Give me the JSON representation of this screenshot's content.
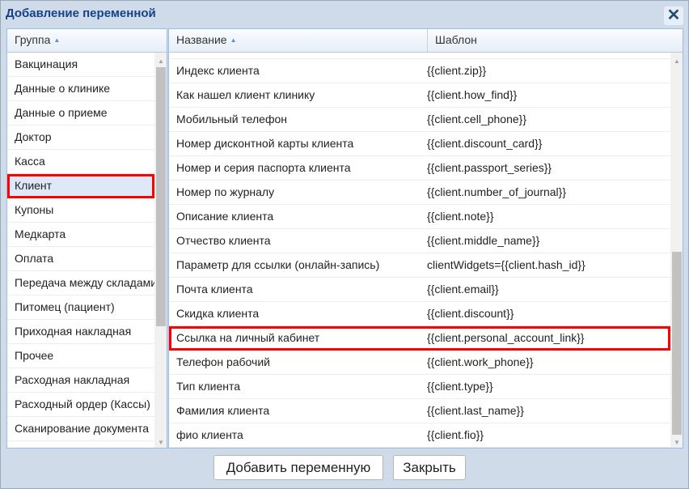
{
  "dialog": {
    "title": "Добавление переменной",
    "close": "✕"
  },
  "groups": {
    "header": "Группа",
    "items": [
      "Вакцинация",
      "Данные о клинике",
      "Данные о приеме",
      "Доктор",
      "Касса",
      "Клиент",
      "Купоны",
      "Медкарта",
      "Оплата",
      "Передача между складами",
      "Питомец (пациент)",
      "Приходная накладная",
      "Прочее",
      "Расходная накладная",
      "Расходный ордер (Кассы)",
      "Сканирование документа"
    ],
    "selected": "Клиент"
  },
  "variables": {
    "header_name": "Название",
    "header_template": "Шаблон",
    "rows": [
      {
        "name": "Индекс клиента",
        "template": "{{client.zip}}"
      },
      {
        "name": "Как нашел клиент клинику",
        "template": "{{client.how_find}}"
      },
      {
        "name": "Мобильный телефон",
        "template": "{{client.cell_phone}}"
      },
      {
        "name": "Номер дисконтной карты клиента",
        "template": "{{client.discount_card}}"
      },
      {
        "name": "Номер и серия паспорта клиента",
        "template": "{{client.passport_series}}"
      },
      {
        "name": "Номер по журналу",
        "template": "{{client.number_of_journal}}"
      },
      {
        "name": "Описание клиента",
        "template": "{{client.note}}"
      },
      {
        "name": "Отчество клиента",
        "template": "{{client.middle_name}}"
      },
      {
        "name": "Параметр для ссылки (онлайн-запись)",
        "template": "clientWidgets={{client.hash_id}}"
      },
      {
        "name": "Почта клиента",
        "template": "{{client.email}}"
      },
      {
        "name": "Скидка клиента",
        "template": "{{client.discount}}"
      },
      {
        "name": "Ссылка на личный кабинет",
        "template": "{{client.personal_account_link}}"
      },
      {
        "name": "Телефон рабочий",
        "template": "{{client.work_phone}}"
      },
      {
        "name": "Тип клиента",
        "template": "{{client.type}}"
      },
      {
        "name": "Фамилия клиента",
        "template": "{{client.last_name}}"
      },
      {
        "name": "фио клиента",
        "template": "{{client.fio}}"
      }
    ],
    "highlighted": "Ссылка на личный кабинет"
  },
  "buttons": {
    "add": "Добавить переменную",
    "close": "Закрыть"
  }
}
